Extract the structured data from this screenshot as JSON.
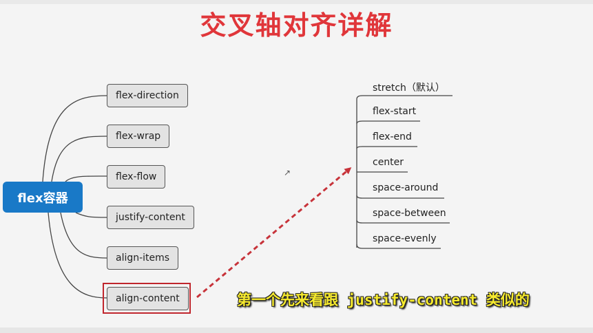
{
  "title": "交叉轴对齐详解",
  "root": {
    "label": "flex容器"
  },
  "properties": [
    {
      "label": "flex-direction"
    },
    {
      "label": "flex-wrap"
    },
    {
      "label": "flex-flow"
    },
    {
      "label": "justify-content"
    },
    {
      "label": "align-items"
    },
    {
      "label": "align-content"
    }
  ],
  "options": [
    {
      "label": "stretch（默认）"
    },
    {
      "label": "flex-start"
    },
    {
      "label": "flex-end"
    },
    {
      "label": "center"
    },
    {
      "label": "space-around"
    },
    {
      "label": "space-between"
    },
    {
      "label": "space-evenly"
    }
  ],
  "subtitle": "第一个先来看跟 justify-content 类似的",
  "colors": {
    "title": "#e0363a",
    "root_bg": "#1979c7",
    "highlight": "#c0262d",
    "arrow": "#c7333a",
    "subtitle": "#f6ea2e"
  }
}
